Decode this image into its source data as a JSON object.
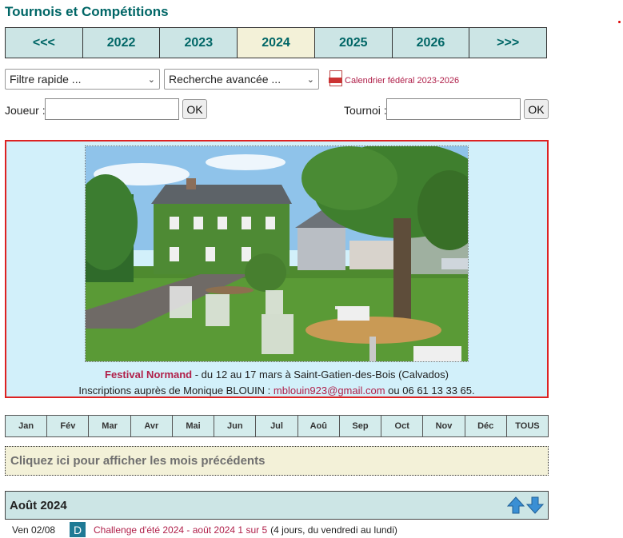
{
  "page": {
    "title": "Tournois et Compétitions"
  },
  "years": [
    {
      "label": "<<<",
      "active": false
    },
    {
      "label": "2022",
      "active": false
    },
    {
      "label": "2023",
      "active": false
    },
    {
      "label": "2024",
      "active": true
    },
    {
      "label": "2025",
      "active": false
    },
    {
      "label": "2026",
      "active": false
    },
    {
      "label": ">>>",
      "active": false
    }
  ],
  "filters": {
    "quick_filter": "Filtre rapide ...",
    "advanced_search": "Recherche avancée ...",
    "calendar_link": "Calendrier fédéral 2023-2026",
    "player_label": "Joueur :",
    "player_value": "",
    "tournament_label": "Tournoi :",
    "tournament_value": "",
    "ok_label": "OK"
  },
  "feature": {
    "festival_name": "Festival Normand",
    "festival_details": " - du 12 au 17 mars à Saint-Gatien-des-Bois (Calvados)",
    "inscriptions_prefix": "Inscriptions auprès de Monique BLOUIN : ",
    "email": "mblouin923@gmail.com",
    "phone_suffix": " ou 06 61 13 33 65."
  },
  "months": [
    "Jan",
    "Fév",
    "Mar",
    "Avr",
    "Mai",
    "Jun",
    "Jul",
    "Aoû",
    "Sep",
    "Oct",
    "Nov",
    "Déc",
    "TOUS"
  ],
  "previous_months_label": "Cliquez ici pour afficher les mois précédents",
  "month_section": {
    "title": "Août 2024",
    "events": [
      {
        "date": "Ven 02/08",
        "badge": "D",
        "title": "Challenge d'été 2024 - août 2024 1 sur 5",
        "details": "(4 jours, du vendredi au lundi)"
      }
    ]
  },
  "colors": {
    "accent_teal": "#006666",
    "link_red": "#b0204a",
    "feature_border": "#dd2222",
    "feature_bg": "#d2f0fa",
    "active_year_bg": "#f3f1d8"
  }
}
